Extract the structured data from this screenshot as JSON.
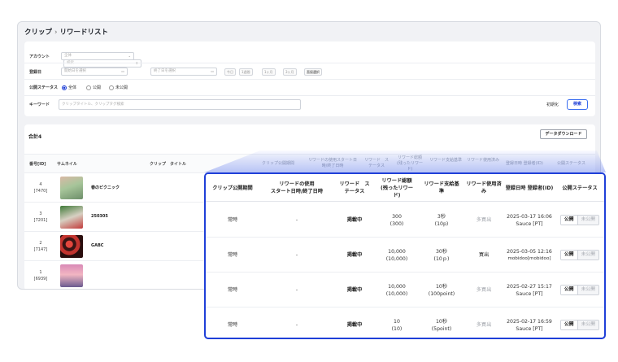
{
  "breadcrumb": {
    "parent": "クリップ",
    "separator": "›",
    "current": "リワードリスト"
  },
  "filter": {
    "account_label": "アカウント",
    "account_value": "全体",
    "account_search_placeholder": "検索",
    "date_label": "登録日",
    "date_from": "開始日を選択",
    "date_to": "終了日を選択",
    "date_presets": [
      "今日",
      "1週間",
      "1ヶ月",
      "3ヶ月",
      "直接選択"
    ],
    "status_label": "公開ステータス",
    "status_options": [
      "全体",
      "公開",
      "未公開"
    ],
    "keyword_label": "キーワード",
    "keyword_placeholder": "クリップタイトル、クリップタグ検索",
    "reset_label": "初期化",
    "search_label": "検索"
  },
  "list": {
    "total_label": "合計4",
    "download_label": "データダウンロード",
    "headers": {
      "id": "番号[ID]",
      "thumbnail": "サムネイル",
      "title": "クリップ　タイトル",
      "period": "クリップ公開期間",
      "usage_dates": "リワードの使用スタート日時/終了日時",
      "status": "リワード　ステータス",
      "amount": "リワード総額(残ったリワード)",
      "criteria": "リワード支給基準",
      "used": "リワード使用済み",
      "registered": "登録日時 登録者(ID)",
      "public": "公開ステータス"
    },
    "rows": [
      {
        "no": "4",
        "id": "[7470]",
        "title": "春のピクニック"
      },
      {
        "no": "3",
        "id": "[7201]",
        "title": "250305"
      },
      {
        "no": "2",
        "id": "[7147]",
        "title": "GABC"
      },
      {
        "no": "1",
        "id": "[6939]",
        "title": ""
      }
    ]
  },
  "zoom": {
    "headers": {
      "period": "クリップ公開期間",
      "usage_dates": "リワードの使用\nスタート日時/終了日時",
      "status": "リワード　ス\nテータス",
      "amount": "リワード総額\n(残ったリワー\nド)",
      "criteria": "リワード支給基\n準",
      "used": "リワード使用済\nみ",
      "registered": "登録日時 登録者(ID)",
      "public": "公開ステータス"
    },
    "rows": [
      {
        "period": "常時",
        "usage": "-",
        "status": "掲載中",
        "amount": "300\n(300)",
        "criteria": "3秒\n(10p)",
        "used": "多買出",
        "date": "2025-03-17 16:06",
        "user": "Sauce [PT]",
        "public_on": "公開",
        "public_off": "未公開"
      },
      {
        "period": "常時",
        "usage": "-",
        "status": "掲載中",
        "amount": "10,000\n(10,000)",
        "criteria": "30秒\n(10ｐ)",
        "used": "買出",
        "date": "2025-03-05 12:16",
        "user": "mobidoo[mobidoo]",
        "public_on": "公開",
        "public_off": "未公開"
      },
      {
        "period": "常時",
        "usage": "-",
        "status": "掲載中",
        "amount": "10,000\n(10,000)",
        "criteria": "10秒\n(100point)",
        "used": "多買出",
        "date": "2025-02-27 15:17",
        "user": "Sauce [PT]",
        "public_on": "公開",
        "public_off": "未公開"
      },
      {
        "period": "常時",
        "usage": "-",
        "status": "掲載中",
        "amount": "10\n(10)",
        "criteria": "10秒\n(5point)",
        "used": "多買出",
        "date": "2025-02-17 16:59",
        "user": "Sauce [PT]",
        "public_on": "公開",
        "public_off": "未公開"
      }
    ]
  },
  "colors": {
    "accent": "#1f3fd8",
    "radio_selected": "#1a3bd6"
  }
}
